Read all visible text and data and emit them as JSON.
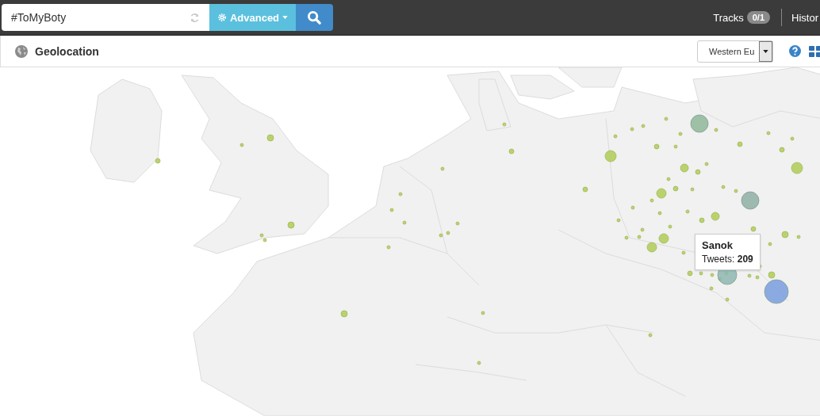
{
  "top_bar": {
    "search": {
      "value": "#ToMyBoty"
    },
    "advanced_button": "Advanced",
    "tracks": {
      "label": "Tracks",
      "count": "0/1"
    },
    "history_link": "Histor"
  },
  "panel": {
    "title": "Geolocation",
    "region_select": {
      "value": "Western Eu"
    }
  },
  "map": {
    "tooltip": {
      "place": "Sanok",
      "label": "Tweets:",
      "value": "209"
    }
  }
}
